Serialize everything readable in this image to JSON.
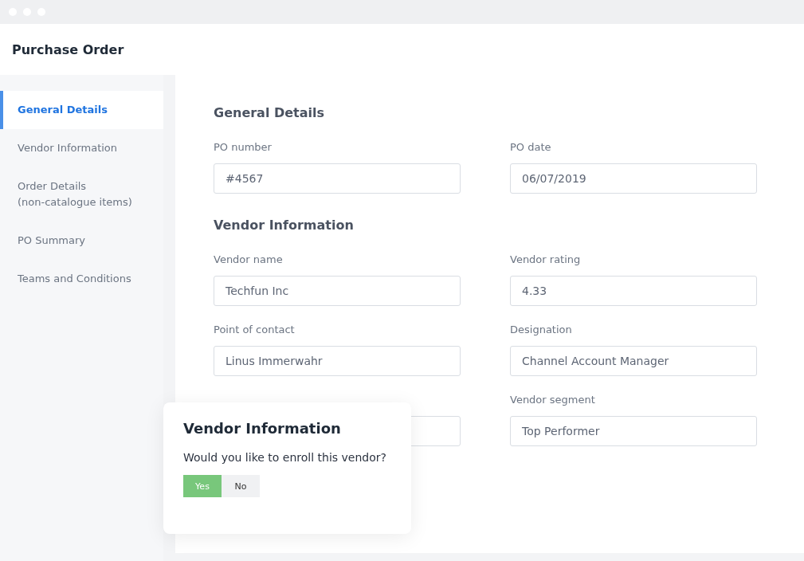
{
  "window": {
    "title": "Purchase Order"
  },
  "sidebar": {
    "items": [
      {
        "label": "General Details",
        "selected": true
      },
      {
        "label": "Vendor Information",
        "selected": false
      },
      {
        "label": "Order Details\n(non-catalogue items)",
        "selected": false
      },
      {
        "label": "PO Summary",
        "selected": false
      },
      {
        "label": "Teams and Conditions",
        "selected": false
      }
    ]
  },
  "sections": [
    {
      "title": "General Details",
      "fields": [
        {
          "kind": "text",
          "label": "PO number",
          "value": "#4567"
        },
        {
          "kind": "text",
          "label": "PO date",
          "value": "06/07/2019"
        }
      ]
    },
    {
      "title": "Vendor Information",
      "fields": [
        {
          "kind": "text",
          "label": "Vendor name",
          "value": "Techfun Inc"
        },
        {
          "kind": "text",
          "label": "Vendor rating",
          "value": "4.33"
        },
        {
          "kind": "text",
          "label": "Point of contact",
          "value": "Linus Immerwahr"
        },
        {
          "kind": "text",
          "label": "Designation",
          "value": "Channel Account Manager"
        },
        {
          "kind": "covered"
        },
        {
          "kind": "text",
          "label": "Vendor segment",
          "value": "Top Performer"
        }
      ]
    }
  ],
  "popup": {
    "title": "Vendor Information",
    "question": "Would you like to enroll this vendor?",
    "options": [
      {
        "label": "Yes",
        "selected": true
      },
      {
        "label": "No",
        "selected": false
      }
    ]
  }
}
